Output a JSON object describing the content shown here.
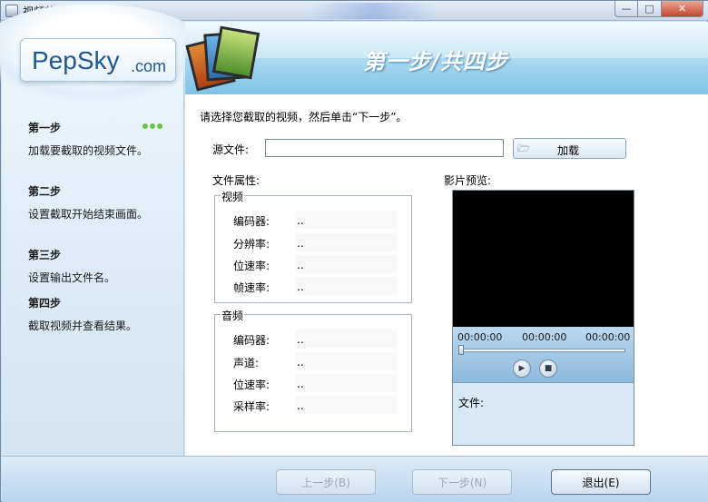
{
  "window": {
    "title": "视频截取专家 4.3",
    "controls": {
      "minimize": "—",
      "maximize": "□",
      "close": "✕"
    }
  },
  "brand": {
    "name": "PepSky",
    "tld": ".com"
  },
  "header": {
    "title": "第一步/共四步"
  },
  "steps": [
    {
      "title": "第一步",
      "desc": "加载要截取的视频文件。",
      "active": true
    },
    {
      "title": "第二步",
      "desc": "设置截取开始结束画面。"
    },
    {
      "title": "第三步",
      "desc": "设置输出文件名。"
    },
    {
      "title": "第四步",
      "desc": "截取视频并查看结果。"
    }
  ],
  "main": {
    "instruction": "请选择您截取的视频，然后单击“下一步”。",
    "source_label": "源文件:",
    "source_value": "",
    "load_button": "加载",
    "properties_label": "文件属性:",
    "preview_label": "影片预览:",
    "video_group": {
      "label": "视频",
      "rows": [
        {
          "label": "编码器:",
          "value": ".."
        },
        {
          "label": "分辨率:",
          "value": ".."
        },
        {
          "label": "位速率:",
          "value": ".."
        },
        {
          "label": "帧速率:",
          "value": ".."
        }
      ]
    },
    "audio_group": {
      "label": "音频",
      "rows": [
        {
          "label": "编码器:",
          "value": ".."
        },
        {
          "label": "声道:",
          "value": ".."
        },
        {
          "label": "位速率:",
          "value": ".."
        },
        {
          "label": "采样率:",
          "value": ".."
        }
      ]
    }
  },
  "preview": {
    "time_start": "00:00:00",
    "time_current": "00:00:00",
    "time_end": "00:00:00",
    "position": 0,
    "file_label": "文件:"
  },
  "footer": {
    "prev": "上一步(B)",
    "next": "下一步(N)",
    "exit": "退出(E)"
  },
  "colors": {
    "accent": "#7fc3e6",
    "step_indicator": "#6fc04a",
    "video_bg": "#000000"
  }
}
